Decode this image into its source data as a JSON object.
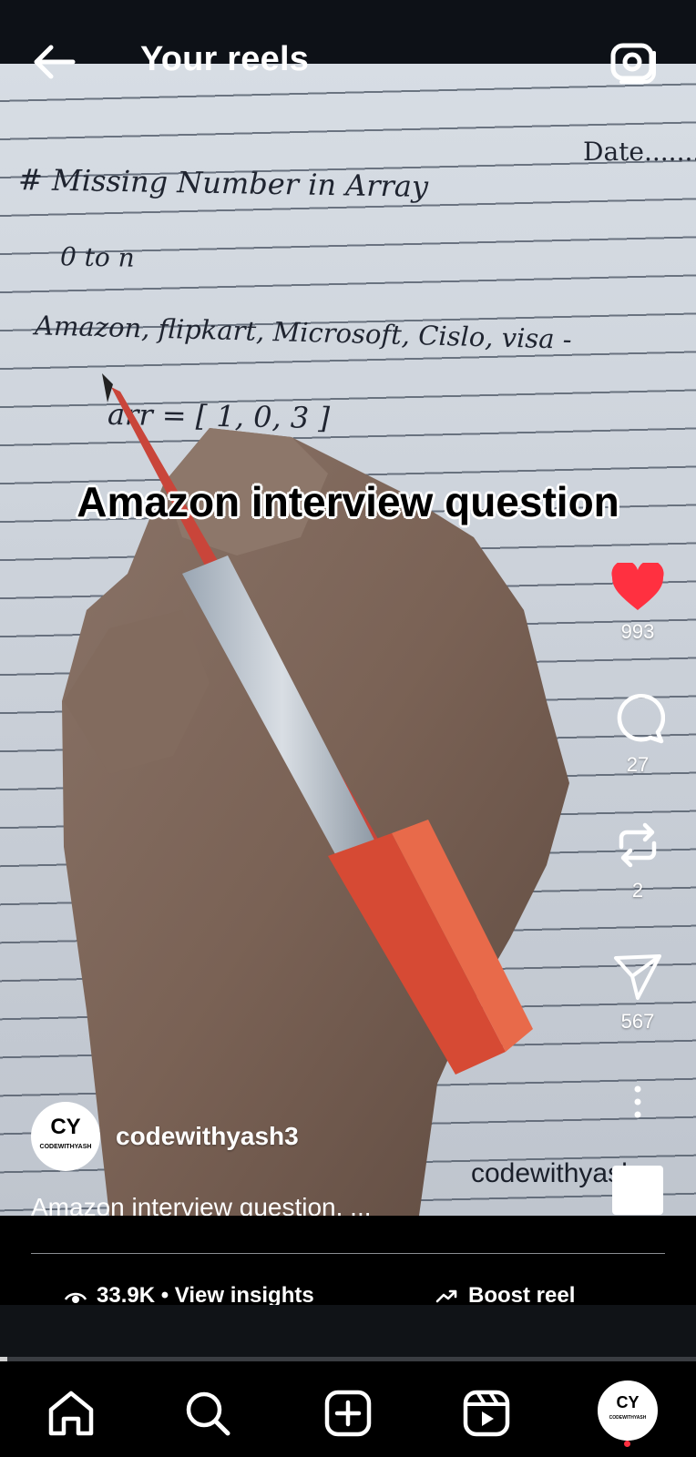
{
  "header": {
    "title": "Your reels"
  },
  "reel": {
    "overlay_text": "Amazon interview question",
    "notebook": {
      "date_label": "Date........",
      "heading": "# Missing Number in Array",
      "line2": "0 to n",
      "line3": "Amazon, flipkart, Microsoft, Cislo, visa -",
      "line4": "arr = [ 1, 0, 3 ]"
    },
    "watermark_text": "codewithyash",
    "username": "codewithyash3",
    "avatar_logo": "CY",
    "avatar_brand": "CODEWITHYASH",
    "caption": "Amazon interview question. ..."
  },
  "actions": {
    "likes": "993",
    "comments": "27",
    "reposts": "2",
    "shares": "567"
  },
  "insights": {
    "views_label": "33.9K • View insights",
    "boost_label": "Boost reel"
  },
  "playback": {
    "progress_fraction": 0.01
  },
  "icons": {
    "back": "arrow-left-icon",
    "camera": "camera-icon",
    "like": "heart-icon",
    "comment": "comment-icon",
    "repost": "repost-icon",
    "share": "send-icon",
    "more": "more-vertical-icon",
    "views": "eye-icon",
    "boost": "trending-up-icon",
    "home": "home-icon",
    "search": "search-icon",
    "create": "plus-square-icon",
    "reels": "reels-icon"
  },
  "colors": {
    "like": "#ff3040",
    "background": "#000000",
    "accent_text": "#ffffff"
  }
}
